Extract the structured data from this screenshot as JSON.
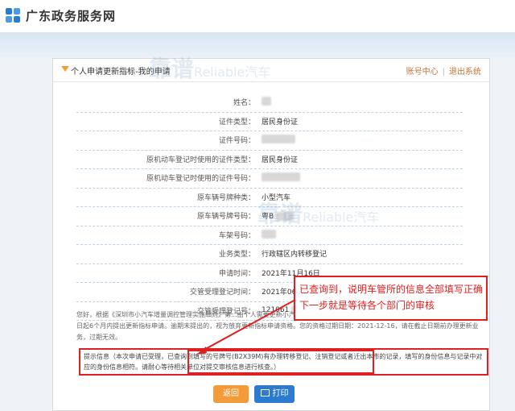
{
  "site": {
    "title": "广东政务服务网"
  },
  "panel": {
    "title": "个人申请更新指标-我的申请",
    "links": {
      "account": "账号中心",
      "logout": "退出系统"
    }
  },
  "rows": [
    {
      "label": "姓名：",
      "value": ""
    },
    {
      "label": "证件类型：",
      "value": "居民身份证"
    },
    {
      "label": "证件号码：",
      "value": ""
    },
    {
      "label": "原机动车登记时使用的证件类型：",
      "value": "居民身份证"
    },
    {
      "label": "原机动车登记时使用的证件号码：",
      "value": ""
    },
    {
      "label": "原车辆号牌种类：",
      "value": "小型汽车"
    },
    {
      "label": "原车辆号牌号码：",
      "value": "粤B"
    },
    {
      "label": "车架号码：",
      "value": ""
    },
    {
      "label": "业务类型：",
      "value": "行政辖区内转移登记"
    },
    {
      "label": "申请时间：",
      "value": "2021年11月16日"
    },
    {
      "label": "交管受理登记时间：",
      "value": "2021年06月11日"
    },
    {
      "label": "交管受理登记号：",
      "value": "121061"
    }
  ],
  "notice": "您好，根据《深圳市小汽车增量调控管理实施细则》第...由个人需要更新小汽车的，应当自完成转移登记、注销登记或者迁出本市的变更登记之日起6个月内提出更新指标申请。逾期未提出的，视为放弃更新指标申请资格。您的资格过期日期：2021-12-16，请在截止日期前办理更新业务，过期无效。",
  "tip": "提示信息（本次申请已受理，已查询到填写的号牌号(B2X39M)有办理转移登记、注销登记或者迁出本市的记录，填写的身份信息与记录中对应的身份信息相符。请耐心等待相关单位对提交审核信息进行核查。）",
  "buttons": {
    "back": "返回",
    "print": "打印"
  },
  "callout": {
    "line1": "已查询到，说明车管所的信息全部填写正确",
    "line2": "下一步就是等待各个部门的审核"
  },
  "watermark": {
    "text": "靠谱",
    "sub": "Reliable汽车"
  }
}
